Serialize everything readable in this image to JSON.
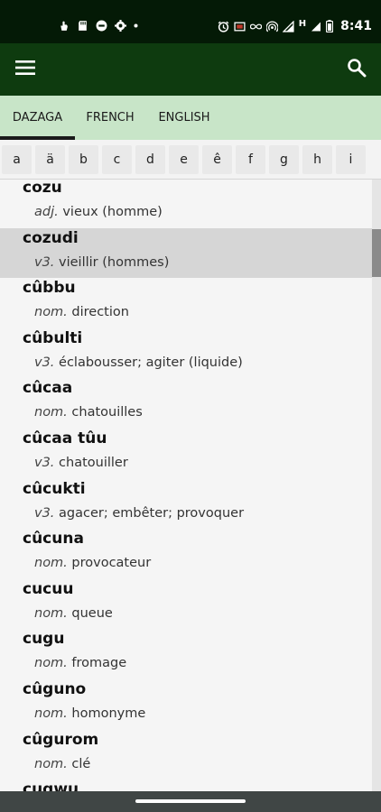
{
  "status_bar": {
    "time": "8:41",
    "network": "H",
    "icons": [
      "hand-touch-icon",
      "sd-card-icon",
      "sync-icon",
      "gear-icon",
      "dot-icon",
      "alarm-icon",
      "cast-icon",
      "infinity-icon",
      "hotspot-icon",
      "signal-icon",
      "battery-icon"
    ]
  },
  "app_bar": {
    "menu_icon": "hamburger-icon",
    "search_icon": "search-icon"
  },
  "tabs": [
    {
      "label": "DAZAGA",
      "active": true
    },
    {
      "label": "FRENCH",
      "active": false
    },
    {
      "label": "ENGLISH",
      "active": false
    }
  ],
  "alphabet": [
    "a",
    "ä",
    "b",
    "c",
    "d",
    "e",
    "ê",
    "f",
    "g",
    "h",
    "i"
  ],
  "entries": [
    {
      "word": "cozu",
      "pos": "adj.",
      "gloss": "vieux (homme)"
    },
    {
      "word": "cozudi",
      "pos": "v3.",
      "gloss": "vieillir (hommes)",
      "selected": true
    },
    {
      "word": "cûbbu",
      "pos": "nom.",
      "gloss": "direction"
    },
    {
      "word": "cûbulti",
      "pos": "v3.",
      "gloss": "éclabousser; agiter (liquide)"
    },
    {
      "word": "cûcaa",
      "pos": "nom.",
      "gloss": "chatouilles"
    },
    {
      "word": "cûcaa tûu",
      "pos": "v3.",
      "gloss": "chatouiller"
    },
    {
      "word": "cûcukti",
      "pos": "v3.",
      "gloss": "agacer; embêter; provoquer"
    },
    {
      "word": "cûcuna",
      "pos": "nom.",
      "gloss": "provocateur"
    },
    {
      "word": "cucuu",
      "pos": "nom.",
      "gloss": "queue"
    },
    {
      "word": "cugu",
      "pos": "nom.",
      "gloss": "fromage"
    },
    {
      "word": "cûguno",
      "pos": "nom.",
      "gloss": "homonyme"
    },
    {
      "word": "cûgurom",
      "pos": "nom.",
      "gloss": "clé"
    },
    {
      "word": "cugwu",
      "pos": "",
      "gloss": ""
    }
  ],
  "colors": {
    "status_bar": "#041a06",
    "app_bar": "#0e3b0f",
    "tab_bar": "#c8e5c8",
    "selected_row": "#d6d6d6",
    "nav_bar": "#404645"
  }
}
